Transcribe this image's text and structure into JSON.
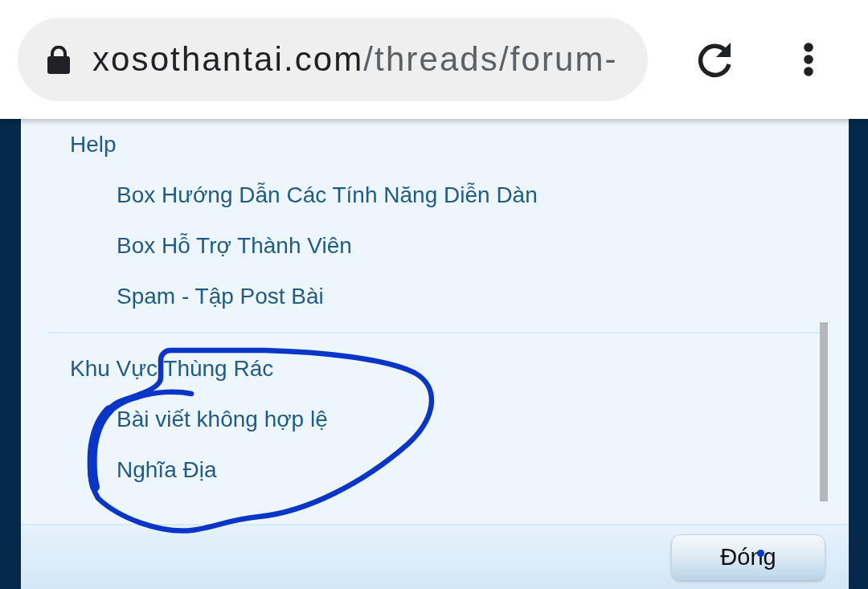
{
  "address_bar": {
    "host": "xosothantai.com",
    "path": "/threads/forum-"
  },
  "forum_list": [
    {
      "title": "Help",
      "children": [
        {
          "title": "Box Hướng Dẫn Các Tính Năng Diễn Dàn"
        },
        {
          "title": "Box Hỗ Trợ Thành Viên"
        },
        {
          "title": "Spam - Tập Post Bài"
        }
      ]
    },
    {
      "title": "Khu Vực Thùng Rác",
      "children": [
        {
          "title": "Bài viết không hợp lệ"
        },
        {
          "title": "Nghĩa Địa"
        }
      ]
    }
  ],
  "buttons": [
    "Đóng"
  ]
}
